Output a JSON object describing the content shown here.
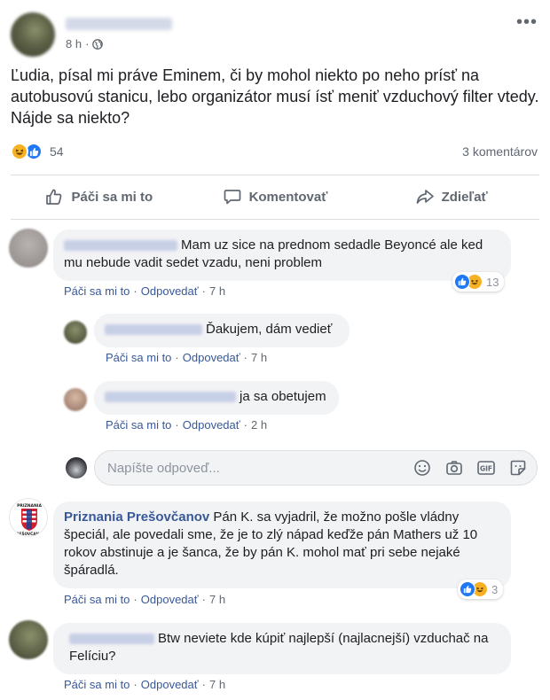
{
  "post": {
    "timestamp": "8 h",
    "text": "Ľudia, písal mi práve Eminem, či by mohol niekto po neho prísť na autobusovú stanicu, lebo organizátor musí ísť meniť vzduchový filter vtedy. Nájde sa niekto?",
    "reaction_count": "54",
    "comments_count": "3 komentárov"
  },
  "actions": {
    "like": "Páči sa mi to",
    "comment": "Komentovať",
    "share": "Zdieľať"
  },
  "comments": [
    {
      "text": "Mam uz sice na prednom sedadle Beyoncé ale ked mu nebude vadit sedet vzadu, neni problem",
      "like": "Páči sa mi to",
      "reply": "Odpovedať",
      "time": "7 h",
      "reactions": "13"
    },
    {
      "text": "Ďakujem, dám vedieť",
      "like": "Páči sa mi to",
      "reply": "Odpovedať",
      "time": "7 h"
    },
    {
      "text": "ja sa obetujem",
      "like": "Páči sa mi to",
      "reply": "Odpovedať",
      "time": "2 h"
    },
    {
      "author": "Priznania Prešovčanov",
      "avatar_text": "PRIZNANIA PREŠOVČANOV",
      "text": "Pán K. sa vyjadril, že možno pošle vládny špeciál, ale povedali sme, že je to zlý nápad keďže pán Mathers už 10 rokov abstinuje a je šanca, že by pán K. mohol mať pri sebe nejaké špáradlá.",
      "like": "Páči sa mi to",
      "reply": "Odpovedať",
      "time": "7 h",
      "reactions": "3"
    },
    {
      "text": "Btw neviete kde kúpiť najlepší (najlacnejší) vzduchač na Felíciu?",
      "like": "Páči sa mi to",
      "reply": "Odpovedať",
      "time": "7 h"
    }
  ],
  "reply_box": {
    "placeholder": "Napíšte odpoveď...",
    "icons": [
      "emoji-icon",
      "camera-icon",
      "gif-icon",
      "sticker-icon"
    ]
  },
  "colors": {
    "link": "#385898",
    "like_blue": "#2078f4",
    "haha_yellow": "#f7b125",
    "bubble": "#f2f3f5",
    "muted": "#606770"
  }
}
